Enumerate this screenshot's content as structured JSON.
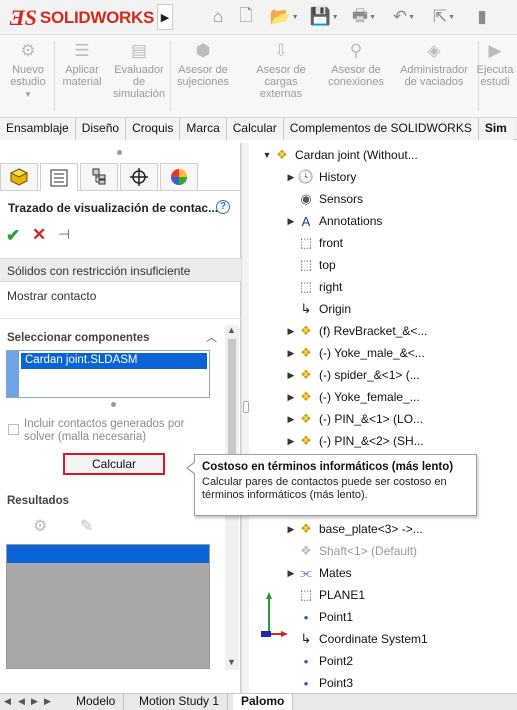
{
  "app": {
    "logo_mark": "ƎS",
    "logo_text": "SOLIDWORKS"
  },
  "colors": {
    "brand_red": "#d52b1e",
    "selection_blue": "#0a64d6",
    "highlight_border": "#e0161e",
    "ok_green": "#2f9e38"
  },
  "quick_access": [
    {
      "name": "home-icon",
      "glyph": "⌂"
    },
    {
      "name": "new-document-icon",
      "glyph": "🗋"
    },
    {
      "name": "open-folder-icon",
      "glyph": "📂"
    },
    {
      "name": "save-icon",
      "glyph": "💾"
    },
    {
      "name": "print-icon",
      "glyph": "🖶"
    },
    {
      "name": "undo-icon",
      "glyph": "↶"
    },
    {
      "name": "select-cursor-icon",
      "glyph": "⇱"
    },
    {
      "name": "rebuild-icon",
      "glyph": "▮"
    }
  ],
  "ribbon": {
    "items": [
      {
        "label1": "Nuevo",
        "label2": "estudio",
        "label3": "",
        "icon": "new-study-icon",
        "glyph": "⚙"
      },
      {
        "label1": "Aplicar",
        "label2": "material",
        "label3": "",
        "icon": "apply-material-icon",
        "glyph": "☰"
      },
      {
        "label1": "Evaluador",
        "label2": "de",
        "label3": "simulación",
        "icon": "simulation-evaluator-icon",
        "glyph": "▤"
      },
      {
        "label1": "Asesor de",
        "label2": "sujeciones",
        "label3": "",
        "icon": "fixtures-advisor-icon",
        "glyph": "⬢"
      },
      {
        "label1": "Asesor de",
        "label2": "cargas externas",
        "label3": "",
        "icon": "external-loads-advisor-icon",
        "glyph": "⇩"
      },
      {
        "label1": "Asesor de",
        "label2": "conexiones",
        "label3": "",
        "icon": "connections-advisor-icon",
        "glyph": "⚲"
      },
      {
        "label1": "Administrador",
        "label2": "de vaciados",
        "label3": "",
        "icon": "shell-manager-icon",
        "glyph": "◈"
      },
      {
        "label1": "Ejecuta",
        "label2": "estudi",
        "label3": "",
        "icon": "run-study-icon",
        "glyph": "▶"
      }
    ]
  },
  "command_tabs": [
    "Ensamblaje",
    "Diseño",
    "Croquis",
    "Marca",
    "Calcular",
    "Complementos de SOLIDWORKS",
    "Sim"
  ],
  "property_manager": {
    "title": "Trazado de visualización de contac...",
    "help": "?",
    "message": "Sólidos con restricción insuficiente",
    "show_contact": "Mostrar contacto",
    "select_components_title": "Seleccionar componentes",
    "selected_item": "Cardan joint.SLDASM",
    "checkbox_label": "Incluir contactos generados por solver (malla necesaria)",
    "calculate_label": "Calcular",
    "results_title": "Resultados"
  },
  "tooltip": {
    "title": "Costoso en términos informáticos (más lento)",
    "body": "Calcular pares de contactos puede ser costoso en términos informáticos (más lento)."
  },
  "tree": [
    {
      "label": "Cardan joint  (Without...",
      "icon": "assembly-icon",
      "glyph": "❖",
      "color": "#d9a400",
      "expander": "▼",
      "indent": 0,
      "dim": false
    },
    {
      "label": "History",
      "icon": "history-icon",
      "glyph": "🕓",
      "color": "#3a6fb0",
      "expander": "▶",
      "indent": 1,
      "dim": false
    },
    {
      "label": "Sensors",
      "icon": "sensors-icon",
      "glyph": "◉",
      "color": "#555",
      "expander": "",
      "indent": 1,
      "dim": false
    },
    {
      "label": "Annotations",
      "icon": "annotations-icon",
      "glyph": "A",
      "color": "#1a3d8c",
      "expander": "▶",
      "indent": 1,
      "dim": false
    },
    {
      "label": "front",
      "icon": "plane-icon",
      "glyph": "⬚",
      "color": "#555",
      "expander": "",
      "indent": 1,
      "dim": false
    },
    {
      "label": "top",
      "icon": "plane-icon",
      "glyph": "⬚",
      "color": "#555",
      "expander": "",
      "indent": 1,
      "dim": false
    },
    {
      "label": "right",
      "icon": "plane-icon",
      "glyph": "⬚",
      "color": "#555",
      "expander": "",
      "indent": 1,
      "dim": false
    },
    {
      "label": "Origin",
      "icon": "origin-icon",
      "glyph": "↳",
      "color": "#222",
      "expander": "",
      "indent": 1,
      "dim": false
    },
    {
      "label": "(f) RevBracket_&<...",
      "icon": "part-icon",
      "glyph": "❖",
      "color": "#d9a400",
      "expander": "▶",
      "indent": 1,
      "dim": false
    },
    {
      "label": "(-) Yoke_male_&<...",
      "icon": "part-icon",
      "glyph": "❖",
      "color": "#d9a400",
      "expander": "▶",
      "indent": 1,
      "dim": false
    },
    {
      "label": "(-) spider_&<1> (...",
      "icon": "part-icon",
      "glyph": "❖",
      "color": "#d9a400",
      "expander": "▶",
      "indent": 1,
      "dim": false
    },
    {
      "label": "(-) Yoke_female_...",
      "icon": "part-icon",
      "glyph": "❖",
      "color": "#d9a400",
      "expander": "▶",
      "indent": 1,
      "dim": false
    },
    {
      "label": "(-) PIN_&<1> (LO...",
      "icon": "part-icon",
      "glyph": "❖",
      "color": "#d9a400",
      "expander": "▶",
      "indent": 1,
      "dim": false
    },
    {
      "label": "(-) PIN_&<2> (SH...",
      "icon": "part-icon",
      "glyph": "❖",
      "color": "#d9a400",
      "expander": "▶",
      "indent": 1,
      "dim": false
    },
    {
      "label": "",
      "icon": "part-icon",
      "glyph": "",
      "color": "#d9a400",
      "expander": "",
      "indent": 1,
      "dim": false
    },
    {
      "label": "",
      "icon": "part-icon",
      "glyph": "",
      "color": "#d9a400",
      "expander": "",
      "indent": 1,
      "dim": false
    },
    {
      "label": "",
      "icon": "part-icon",
      "glyph": "",
      "color": "#d9a400",
      "expander": "",
      "indent": 1,
      "dim": false
    },
    {
      "label": "base_plate<3> ->...",
      "icon": "part-icon",
      "glyph": "❖",
      "color": "#d9a400",
      "expander": "▶",
      "indent": 1,
      "dim": false
    },
    {
      "label": "Shaft<1> (Default)",
      "icon": "suppressed-part-icon",
      "glyph": "❖",
      "color": "#bdbdbd",
      "expander": "",
      "indent": 1,
      "dim": true
    },
    {
      "label": "Mates",
      "icon": "mates-icon",
      "glyph": "⫘",
      "color": "#2e5fa8",
      "expander": "▶",
      "indent": 1,
      "dim": false
    },
    {
      "label": "PLANE1",
      "icon": "plane-icon",
      "glyph": "⬚",
      "color": "#555",
      "expander": "",
      "indent": 1,
      "dim": false
    },
    {
      "label": "Point1",
      "icon": "point-icon",
      "glyph": "•",
      "color": "#2a5da8",
      "expander": "",
      "indent": 1,
      "dim": false
    },
    {
      "label": "Coordinate System1",
      "icon": "coordinate-system-icon",
      "glyph": "↳",
      "color": "#222",
      "expander": "",
      "indent": 1,
      "dim": false
    },
    {
      "label": "Point2",
      "icon": "point-icon",
      "glyph": "•",
      "color": "#2a5da8",
      "expander": "",
      "indent": 1,
      "dim": false
    },
    {
      "label": "Point3",
      "icon": "point-icon",
      "glyph": "•",
      "color": "#2a5da8",
      "expander": "",
      "indent": 1,
      "dim": false
    }
  ],
  "bottom_tabs": [
    {
      "label": "Modelo",
      "active": false
    },
    {
      "label": "Motion Study 1",
      "active": false
    },
    {
      "label": "Palomo",
      "active": true
    }
  ]
}
